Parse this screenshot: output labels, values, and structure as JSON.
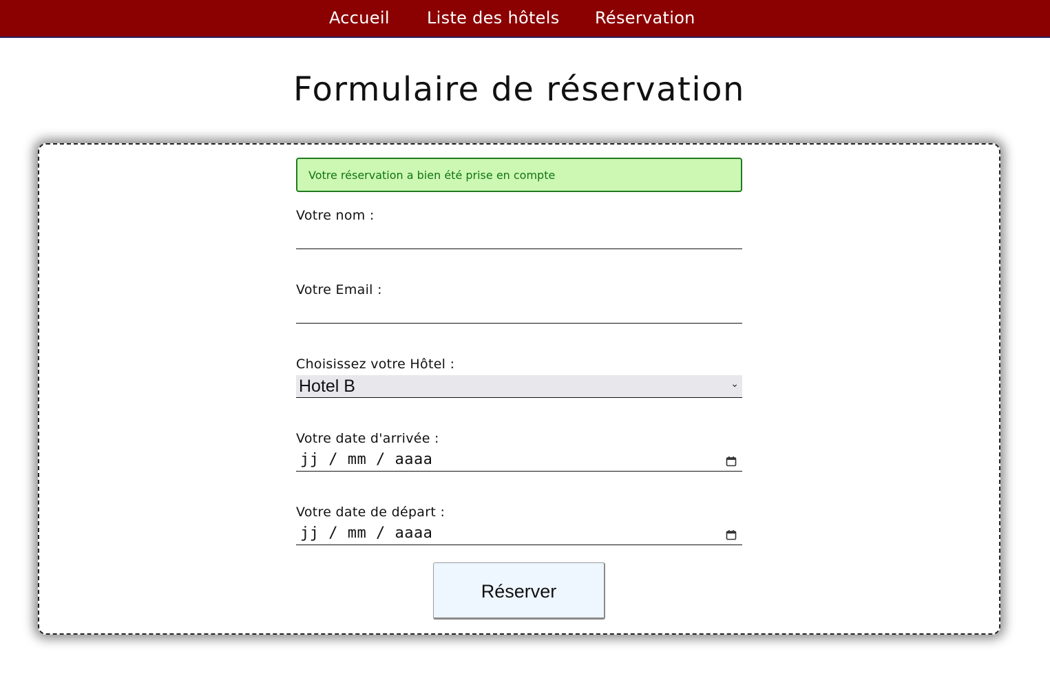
{
  "nav": {
    "items": [
      {
        "label": "Accueil"
      },
      {
        "label": "Liste des hôtels"
      },
      {
        "label": "Réservation"
      }
    ]
  },
  "page": {
    "title": "Formulaire de réservation"
  },
  "form": {
    "success_message": "Votre réservation a bien été prise en compte",
    "name_label": "Votre nom :",
    "name_value": "",
    "email_label": "Votre Email :",
    "email_value": "",
    "hotel_label": "Choisissez votre Hôtel :",
    "hotel_selected": "Hotel B",
    "arrival_label": "Votre date d'arrivée :",
    "arrival_placeholder": "jj / mm / aaaa",
    "departure_label": "Votre date de départ :",
    "departure_placeholder": "jj / mm / aaaa",
    "submit_label": "Réserver"
  },
  "icons": {
    "select_chevron": "chevron-down-icon",
    "date_picker": "calendar-icon"
  },
  "colors": {
    "navbar": "#8b0000",
    "success_bg": "#ccf8b4",
    "success_text": "#137313",
    "button_bg": "#eef6ff"
  }
}
